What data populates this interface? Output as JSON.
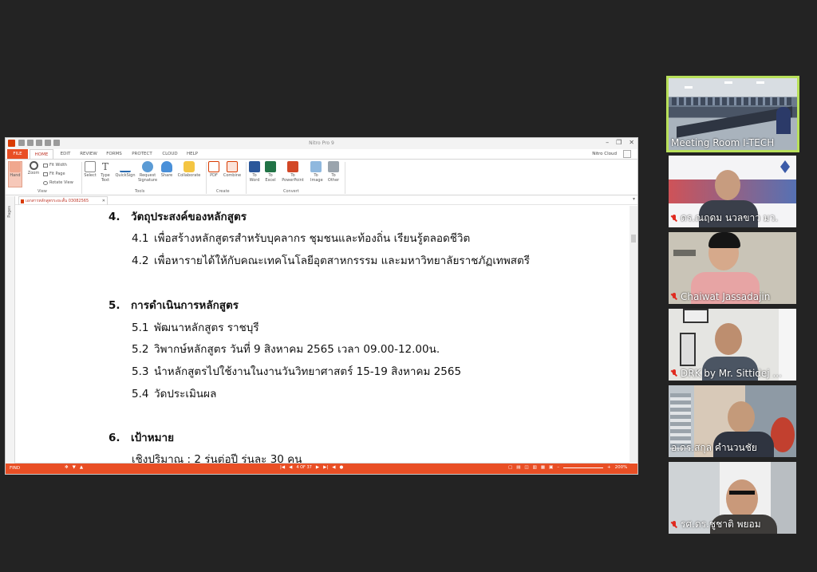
{
  "nitro": {
    "window_title": "Nitro Pro 9",
    "menus": [
      "FILE",
      "HOME",
      "EDIT",
      "REVIEW",
      "FORMS",
      "PROTECT",
      "CLOUD",
      "HELP"
    ],
    "cloud_user": "Nitro Cloud",
    "ribbon": {
      "hand": "Hand",
      "zoom": "Zoom",
      "fit_width": "Fit Width",
      "fit_page": "Fit Page",
      "rotate_view": "Rotate View",
      "group_view": "View",
      "select": "Select",
      "type_text": "Type Text",
      "quicksign": "QuickSign",
      "request_signature": "Request Signature",
      "share": "Share",
      "collaborate": "Collaborate",
      "group_tools": "Tools",
      "pdf": "PDF",
      "combine": "Combine",
      "group_create": "Create",
      "to_word": "To Word",
      "to_excel": "To Excel",
      "to_powerpoint": "To PowerPoint",
      "to_image": "To Image",
      "to_other": "To Other",
      "group_convert": "Convert"
    },
    "pages_label": "Pages",
    "doc_tab": "เอกสารหลักสูตรระยะสั้น 03082565",
    "status": {
      "find": "FIND",
      "page_indicator": "4 OF 37",
      "zoom": "200%"
    }
  },
  "document": {
    "lines": [
      {
        "num": "4.",
        "text": "วัตถุประสงค์ของหลักสูตร",
        "kind": "heading"
      },
      {
        "num": "4.1",
        "text": "เพื่อสร้างหลักสูตรสำหรับบุคลากร ชุมชนและท้องถิ่น เรียนรู้ตลอดชีวิต",
        "kind": "item"
      },
      {
        "num": "4.2",
        "text": "เพื่อหารายได้ให้กับคณะเทคโนโลยีอุตสาหกรรรม และมหาวิทยาลัยราชภัฏเทพสตรี",
        "kind": "item"
      },
      {
        "num": "5.",
        "text": "การดำเนินการหลักสูตร",
        "kind": "heading"
      },
      {
        "num": "5.1",
        "text": "พัฒนาหลักสูตร ราชบุรี",
        "kind": "item"
      },
      {
        "num": "5.2",
        "text": "วิพากษ์หลักสูตร วันที่ 9 สิงหาคม 2565 เวลา 09.00-12.00น.",
        "kind": "item"
      },
      {
        "num": "5.3",
        "text": "นำหลักสูตรไปใช้งานในงานวันวิทยาศาสตร์ 15-19 สิงหาคม 2565",
        "kind": "item"
      },
      {
        "num": "5.4",
        "text": "วัดประเมินผล",
        "kind": "item"
      },
      {
        "num": "6.",
        "text": "เป้าหมาย",
        "kind": "heading"
      },
      {
        "num": "",
        "text": "เชิงปริมาณ :         2 รุ่นต่อปี รุ่นละ 30 คน",
        "kind": "plain"
      }
    ]
  },
  "participants": [
    {
      "name": "Meeting Room I-TECH",
      "muted": false,
      "active": true
    },
    {
      "name": "ดร.ณฤดม นวลขาว  มว.",
      "muted": true,
      "active": false
    },
    {
      "name": "Chaiwat  Jassadajin",
      "muted": true,
      "active": false
    },
    {
      "name": "DRK by Mr. Sittidej ...",
      "muted": true,
      "active": false
    },
    {
      "name": "อ.ดร.สกุล คำนวนชัย",
      "muted": false,
      "active": false
    },
    {
      "name": "รศ.ดร.ชูชาติ  พยอม",
      "muted": true,
      "active": false
    }
  ],
  "colors": {
    "nitro_accent": "#e94f25",
    "active_speaker": "#b8e05a",
    "mic_muted": "#e02b20"
  }
}
